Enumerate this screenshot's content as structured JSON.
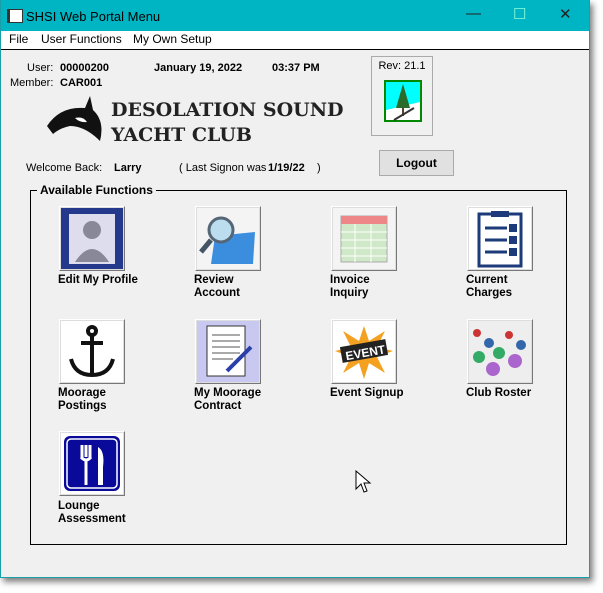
{
  "window": {
    "title": "SHSI Web Portal Menu",
    "minimize": "—",
    "maximize": "☐",
    "close": "✕"
  },
  "menu": [
    "File",
    "User Functions",
    "My Own Setup"
  ],
  "header": {
    "user_label": "User:",
    "user": "00000200",
    "member_label": "Member:",
    "member": "CAR001",
    "date": "January 19, 2022",
    "time": "03:37 PM",
    "rev": "Rev: 21.1",
    "club_line1": "DESOLATION SOUND",
    "club_line2": "YACHT CLUB",
    "welcome_label": "Welcome Back:",
    "welcome_name": "Larry",
    "last_signon_label": "( Last Signon was",
    "last_signon": "1/19/22",
    "last_signon_close": ")"
  },
  "logout": "Logout",
  "group_title": "Available Functions",
  "functions": [
    {
      "l1": "Edit My Profile",
      "l2": "",
      "icon": "profile-icon"
    },
    {
      "l1": "Review",
      "l2": "Account",
      "icon": "magnifier-folder-icon"
    },
    {
      "l1": "Invoice",
      "l2": "Inquiry",
      "icon": "spreadsheet-icon"
    },
    {
      "l1": "Current",
      "l2": "Charges",
      "icon": "clipboard-checklist-icon"
    },
    {
      "l1": "Moorage",
      "l2": "Postings",
      "icon": "anchor-icon"
    },
    {
      "l1": "My Moorage",
      "l2": "Contract",
      "icon": "contract-pen-icon"
    },
    {
      "l1": "Event Signup",
      "l2": "",
      "icon": "event-icon"
    },
    {
      "l1": "Club Roster",
      "l2": "",
      "icon": "crowd-icon"
    },
    {
      "l1": "Lounge",
      "l2": "Assessment",
      "icon": "fork-knife-icon"
    }
  ]
}
